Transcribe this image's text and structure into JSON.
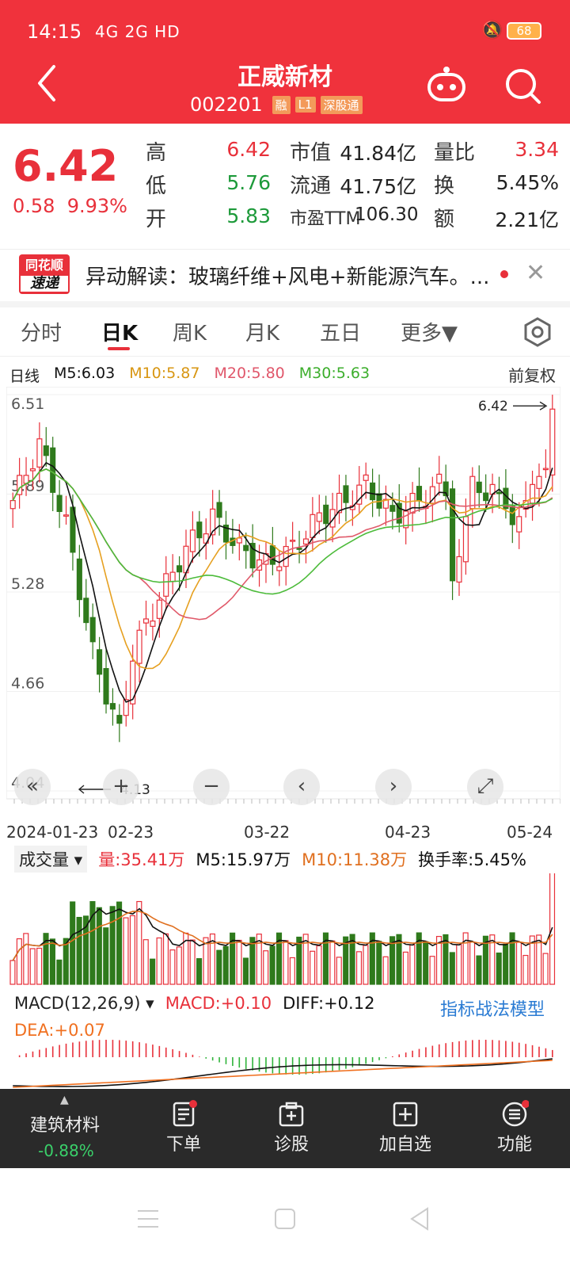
{
  "status": {
    "time": "14:15",
    "network": "4G 2G HD",
    "battery": "68"
  },
  "header": {
    "title": "正威新材",
    "code": "002201",
    "tags": [
      "融",
      "L1",
      "深股通"
    ]
  },
  "quote": {
    "price": "6.42",
    "change": "0.58",
    "change_pct": "9.93%",
    "high_label": "高",
    "high": "6.42",
    "low_label": "低",
    "low": "5.76",
    "open_label": "开",
    "open": "5.83",
    "mktcap_label": "市值",
    "mktcap": "41.84亿",
    "float_label": "流通",
    "float": "41.75亿",
    "pe_label": "市盈TTM",
    "pe": "106.30",
    "volratio_label": "量比",
    "volratio": "3.34",
    "turnover_label": "换",
    "turnover": "5.45%",
    "amount_label": "额",
    "amount": "2.21亿"
  },
  "news": {
    "logo_top": "同花顺",
    "logo_bottom": "速递",
    "text": "异动解读：玻璃纤维+风电+新能源汽车。..."
  },
  "tabs": [
    "分时",
    "日K",
    "周K",
    "月K",
    "五日",
    "更多▼"
  ],
  "ma": {
    "label": "日线",
    "m5": "M5:6.03",
    "m10": "M10:5.87",
    "m20": "M20:5.80",
    "m30": "M30:5.63",
    "adjust": "前复权"
  },
  "chart_data": {
    "type": "candlestick",
    "y_ticks": [
      "6.51",
      "5.89",
      "5.28",
      "4.66",
      "4.04"
    ],
    "ylim": [
      4.04,
      6.51
    ],
    "x_ticks": [
      "2024-01-23",
      "02-23",
      "03-22",
      "04-23",
      "05-24"
    ],
    "high_label": "6.42",
    "low_label": "4.13",
    "series_colors": {
      "up": "#e8303a",
      "down": "#2f7a1c",
      "m5": "#111111",
      "m10": "#e6a020",
      "m20": "#e05a6a",
      "m30": "#4cbb3a"
    }
  },
  "volume": {
    "selector": "成交量",
    "vol": "量:35.41万",
    "m5": "M5:15.97万",
    "m10": "M10:11.38万",
    "turnover": "换手率:5.45%"
  },
  "macd": {
    "selector": "MACD(12,26,9)",
    "macd": "MACD:+0.10",
    "diff": "DIFF:+0.12",
    "dea": "DEA:+0.07",
    "model": "指标战法模型"
  },
  "bottombar": {
    "sector": "建筑材料",
    "sector_change": "-0.88%",
    "items": [
      "下单",
      "诊股",
      "加自选",
      "功能"
    ]
  }
}
